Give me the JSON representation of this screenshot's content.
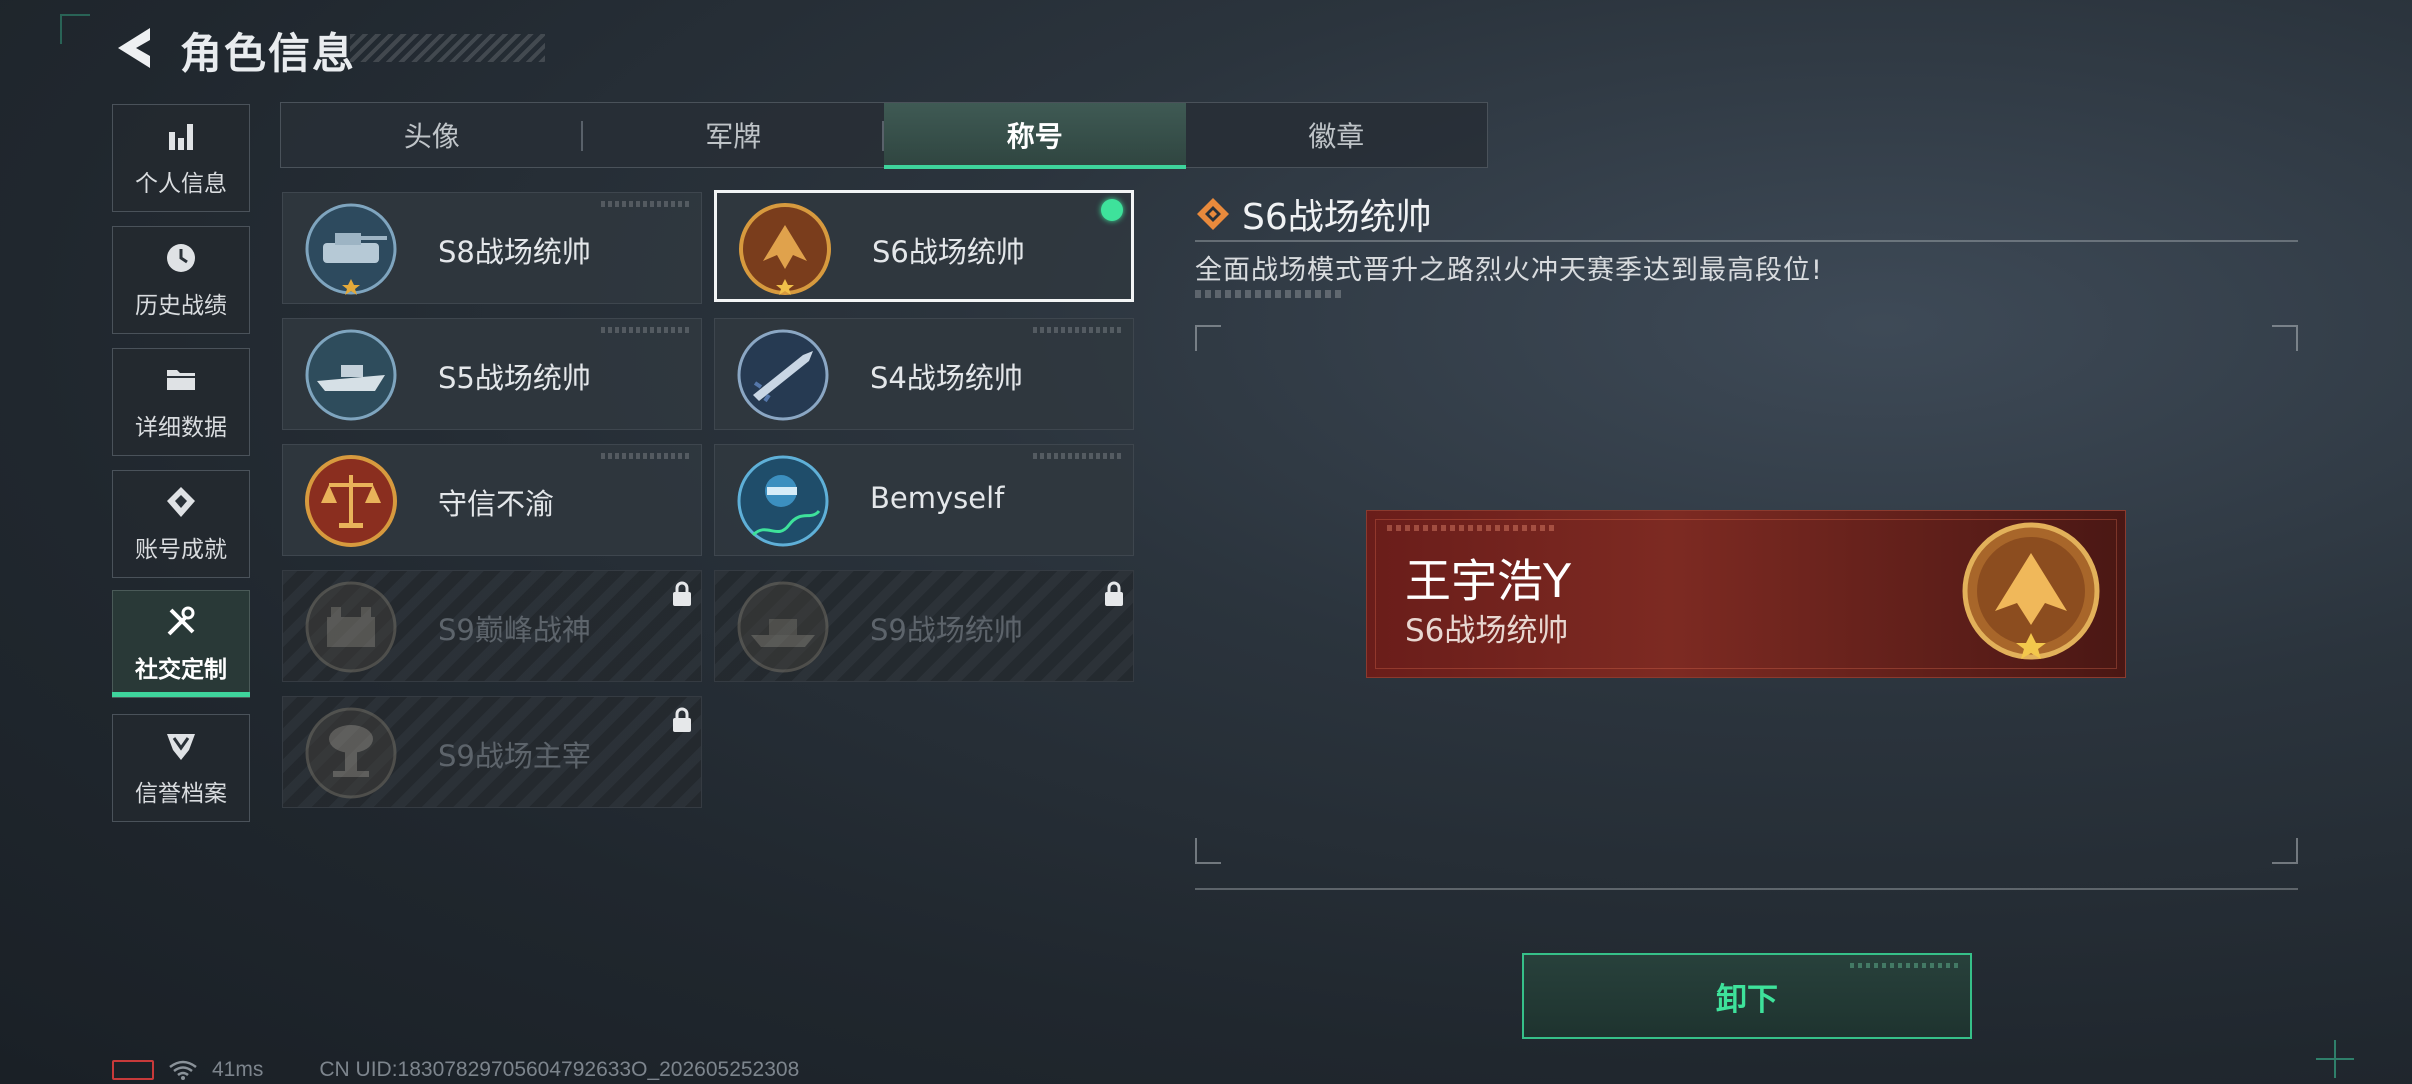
{
  "header": {
    "title": "角色信息"
  },
  "sidebar": {
    "items": [
      {
        "label": "个人信息",
        "icon": "bar-chart-icon"
      },
      {
        "label": "历史战绩",
        "icon": "history-clock-icon"
      },
      {
        "label": "详细数据",
        "icon": "folder-icon"
      },
      {
        "label": "账号成就",
        "icon": "achievement-icon"
      },
      {
        "label": "社交定制",
        "icon": "tools-icon",
        "active": true
      },
      {
        "label": "信誉档案",
        "icon": "reputation-icon"
      }
    ]
  },
  "tabs": [
    {
      "label": "头像"
    },
    {
      "label": "军牌"
    },
    {
      "label": "称号",
      "active": true
    },
    {
      "label": "徽章"
    }
  ],
  "titles": [
    {
      "name": "S8战场统帅",
      "medal": "tank-medal-icon",
      "locked": false
    },
    {
      "name": "S6战场统帅",
      "medal": "jet-medal-icon",
      "locked": false,
      "selected": true,
      "equipped": true
    },
    {
      "name": "S5战场统帅",
      "medal": "boat-medal-icon",
      "locked": false
    },
    {
      "name": "S4战场统帅",
      "medal": "missile-medal-icon",
      "locked": false
    },
    {
      "name": "守信不渝",
      "medal": "scales-medal-icon",
      "locked": false
    },
    {
      "name": "Bemyself",
      "medal": "soldier-signature-medal-icon",
      "locked": false
    },
    {
      "name": "S9巅峰战神",
      "medal": "fortress-medal-icon",
      "locked": true
    },
    {
      "name": "S9战场统帅",
      "medal": "ship-medal-icon",
      "locked": true
    },
    {
      "name": "S9战场主宰",
      "medal": "mushroom-cloud-medal-icon",
      "locked": true
    }
  ],
  "detail": {
    "title": "S6战场统帅",
    "description": "全面战场模式晋升之路烈火冲天赛季达到最高段位!"
  },
  "preview": {
    "player_name": "王宇浩Y",
    "title": "S6战场统帅"
  },
  "actions": {
    "unequip_label": "卸下"
  },
  "status": {
    "ping": "41ms",
    "uid": "CN UID:18307829705604792633O_202605252308"
  },
  "colors": {
    "accent": "#3ed49c",
    "banner": "#7d2a22",
    "medal_gold": "#d7a24a",
    "battery_low": "#c83a3a"
  }
}
